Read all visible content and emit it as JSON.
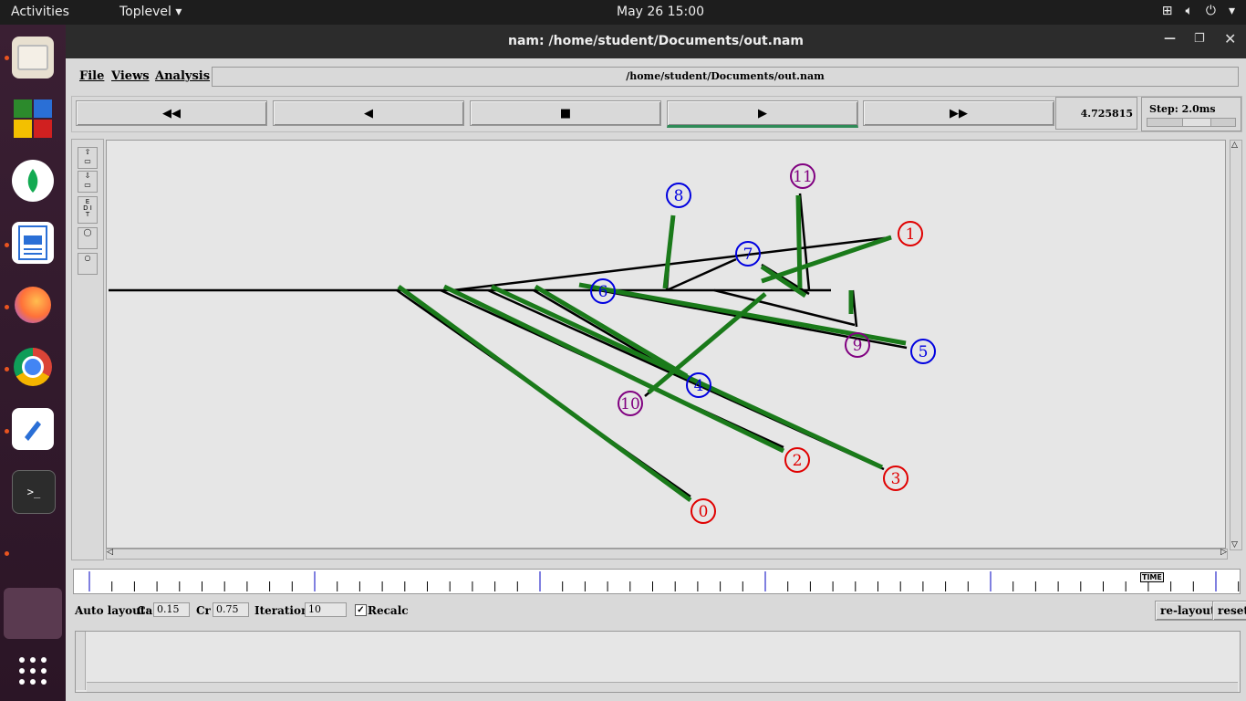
{
  "topbar": {
    "activities": "Activities",
    "app_menu": "Toplevel ▾",
    "clock": "May 26  15:00"
  },
  "window": {
    "title": "nam: /home/student/Documents/out.nam"
  },
  "menu": {
    "file": "File",
    "views": "Views",
    "analysis": "Analysis",
    "file_path": "/home/student/Documents/out.nam"
  },
  "controls": {
    "rewind": "◀◀",
    "back": "◀",
    "stop": "■",
    "play": "▶",
    "ffwd": "▶▶",
    "time": "4.725815",
    "step": "Step: 2.0ms"
  },
  "left_tools": {
    "edit": "E D I T"
  },
  "nodes": [
    {
      "id": "0",
      "color": "red"
    },
    {
      "id": "1",
      "color": "red"
    },
    {
      "id": "2",
      "color": "red"
    },
    {
      "id": "3",
      "color": "red"
    },
    {
      "id": "4",
      "color": "blue"
    },
    {
      "id": "5",
      "color": "blue"
    },
    {
      "id": "6",
      "color": "blue"
    },
    {
      "id": "7",
      "color": "blue"
    },
    {
      "id": "8",
      "color": "blue"
    },
    {
      "id": "9",
      "color": "purple"
    },
    {
      "id": "10",
      "color": "purple"
    },
    {
      "id": "11",
      "color": "purple"
    }
  ],
  "timeline": {
    "marker": "TIME"
  },
  "autolayout": {
    "label": "Auto layout:",
    "ca_label": "Ca",
    "ca": "0.15",
    "cr_label": "Cr",
    "cr": "0.75",
    "iter_label": "Iterations",
    "iter": "10",
    "recalc": "Recalc",
    "relayout": "re-layout",
    "reset": "reset"
  },
  "colors": {
    "red": "#e00000",
    "blue": "#0000e0",
    "purple": "#800080",
    "green": "#1a7a1a"
  }
}
